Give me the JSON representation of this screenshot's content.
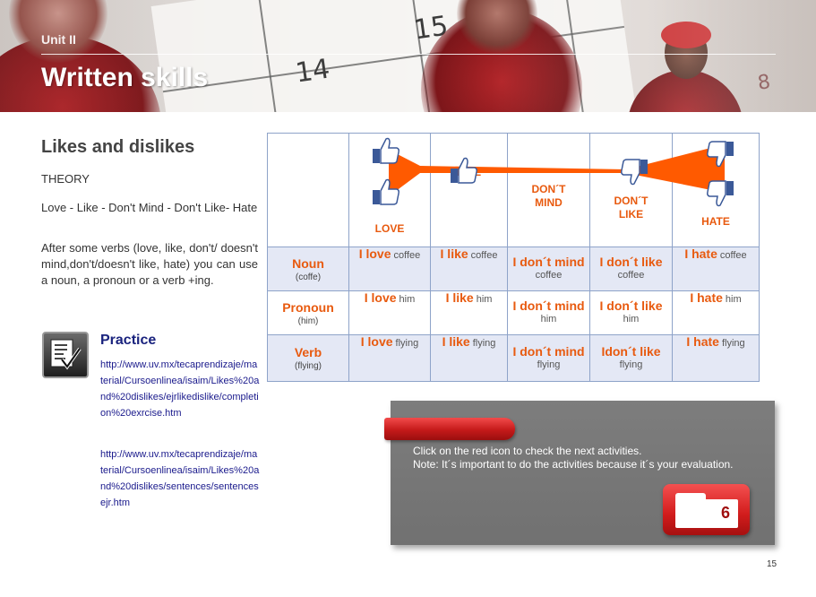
{
  "header": {
    "unit": "Unit II",
    "title": "Written skills",
    "calendar_numbers": [
      "15",
      "14",
      "8"
    ]
  },
  "content": {
    "section_title": "Likes and dislikes",
    "theory_label": "THEORY",
    "verbs_line": "Love - Like - Don't Mind - Don't Like- Hate",
    "theory_text": "After some verbs (love, like, don't/ doesn't mind,don't/doesn't like, hate) you can use a noun, a pronoun or a verb +ing.",
    "practice_title": "Practice",
    "links": [
      "http://www.uv.mx/tecaprendizaje/material/Cursoenlinea/isaim/Likes%20and%20dislikes/ejrlikedislike/completion%20exrcise.htm",
      "http://www.uv.mx/tecaprendizaje/material/Cursoenlinea/isaim/Likes%20and%20dislikes/sentences/sentencesejr.htm"
    ]
  },
  "table": {
    "columns": [
      {
        "l1": "LOVE",
        "l2": ""
      },
      {
        "l1": "LIKE",
        "l2": ""
      },
      {
        "l1": "DON´T",
        "l2": "MIND"
      },
      {
        "l1": "DON´T",
        "l2": "LIKE"
      },
      {
        "l1": "HATE",
        "l2": ""
      }
    ],
    "rows": [
      {
        "label": "Noun",
        "sublabel": "(coffe)",
        "cells": [
          {
            "a": "I love",
            "b": "coffee"
          },
          {
            "a": "I like",
            "b": "coffee"
          },
          {
            "a": "I don´t mind",
            "b": "coffee"
          },
          {
            "a": "I don´t like",
            "b": "coffee"
          },
          {
            "a": "I hate",
            "b": "coffee"
          }
        ]
      },
      {
        "label": "Pronoun",
        "sublabel": "(him)",
        "cells": [
          {
            "a": "I love",
            "b": "him"
          },
          {
            "a": "I like",
            "b": "him"
          },
          {
            "a": "I don´t mind",
            "b": "him"
          },
          {
            "a": "I don´t like",
            "b": "him"
          },
          {
            "a": "I hate",
            "b": "him"
          }
        ]
      },
      {
        "label": "Verb",
        "sublabel": "(flying)",
        "cells": [
          {
            "a": "I love",
            "b": "flying"
          },
          {
            "a": "I like",
            "b": "flying"
          },
          {
            "a": "I don´t mind",
            "b": "flying"
          },
          {
            "a": "Idon´t like",
            "b": "flying"
          },
          {
            "a": "I hate",
            "b": "flying"
          }
        ]
      }
    ]
  },
  "note": {
    "line1": "Click on the red icon to check the next activities.",
    "line2": "Note: It´s important to do the activities because it´s your evaluation.",
    "activity_number": "6"
  },
  "footer": {
    "page_number": "15"
  },
  "colors": {
    "accent_orange": "#e85a0f",
    "grid_border": "#8ea3c9",
    "band": "#e4e8f5",
    "link": "#1a1a8c",
    "panel": "#777777",
    "red": "#d11c1c",
    "thumb_blue": "#3b5998"
  }
}
